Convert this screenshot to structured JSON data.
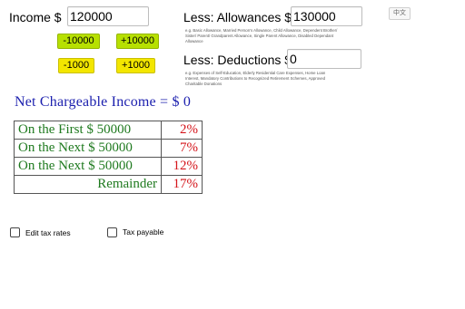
{
  "language_toggle": "中文",
  "income": {
    "label": "Income $",
    "value": "120000"
  },
  "income_buttons": {
    "minus_10000": "-10000",
    "plus_10000": "+10000",
    "minus_1000": "-1000",
    "plus_1000": "+1000"
  },
  "allowances": {
    "label": "Less: Allowances $",
    "value": "130000",
    "note": "e.g. Basic Allowance, Married Person's Allowance, Child Allowance, Dependent Brother/ Sister/ Parent/ Grandparent Allowance, Single Parent Allowance, Disabled Dependant Allowance"
  },
  "deductions": {
    "label": "Less: Deductions $",
    "value": "0",
    "note": "e.g. Expenses of Self-Education, Elderly Residential Care Expenses, Home Loan Interest, Mandatory Contributions to Recognized Retirement Schemes, Approved Charitable Donations"
  },
  "net_chargeable": "Net Chargeable Income = $ 0",
  "brackets": [
    {
      "band": "On the First $ 50000",
      "rate": "2%"
    },
    {
      "band": "On the Next $ 50000",
      "rate": "7%"
    },
    {
      "band": "On the Next $ 50000",
      "rate": "12%"
    },
    {
      "band": "Remainder",
      "rate": "17%"
    }
  ],
  "options": {
    "edit_tax_rates": "Edit tax rates",
    "tax_payable": "Tax payable"
  },
  "colors": {
    "net_text": "#1b1fae",
    "band_text": "#1f7a1f",
    "rate_text": "#d4141a",
    "button_green": "#b7e000",
    "button_yellow": "#f3e600"
  }
}
